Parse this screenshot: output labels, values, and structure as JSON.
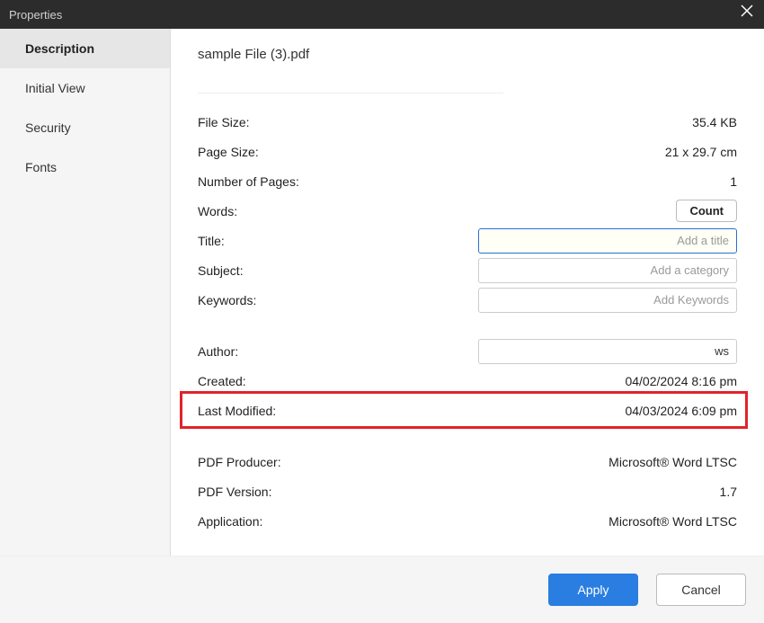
{
  "window": {
    "title": "Properties"
  },
  "sidebar": {
    "tabs": [
      {
        "label": "Description"
      },
      {
        "label": "Initial View"
      },
      {
        "label": "Security"
      },
      {
        "label": "Fonts"
      }
    ]
  },
  "file": {
    "name": "sample File (3).pdf"
  },
  "props": {
    "file_size_label": "File Size:",
    "file_size_value": "35.4 KB",
    "page_size_label": "Page Size:",
    "page_size_value": "21 x 29.7 cm",
    "pages_label": "Number of Pages:",
    "pages_value": "1",
    "words_label": "Words:",
    "count_button": "Count",
    "title_label": "Title:",
    "title_placeholder": "Add a title",
    "subject_label": "Subject:",
    "subject_placeholder": "Add a category",
    "keywords_label": "Keywords:",
    "keywords_placeholder": "Add Keywords",
    "author_label": "Author:",
    "author_value": "ws",
    "created_label": "Created:",
    "created_value": "04/02/2024 8:16 pm",
    "modified_label": "Last Modified:",
    "modified_value": "04/03/2024 6:09 pm",
    "producer_label": "PDF Producer:",
    "producer_value": "Microsoft® Word LTSC",
    "version_label": "PDF Version:",
    "version_value": "1.7",
    "application_label": "Application:",
    "application_value": "Microsoft® Word LTSC"
  },
  "footer": {
    "apply": "Apply",
    "cancel": "Cancel"
  }
}
